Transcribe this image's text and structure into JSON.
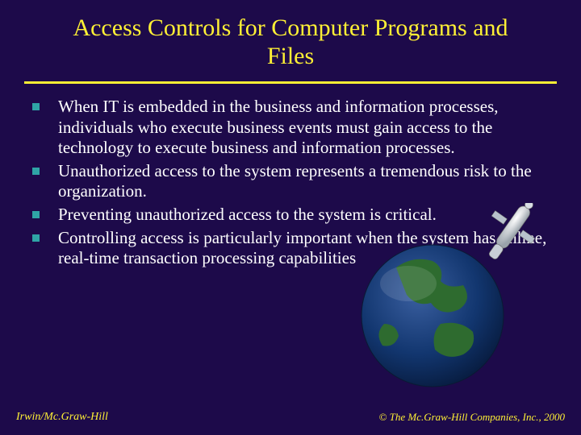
{
  "title": "Access Controls for Computer Programs and Files",
  "bullets": [
    "When IT is embedded in the business and information processes, individuals who execute business events must gain access to the technology to execute business and information processes.",
    "Unauthorized access to the system represents a tremendous risk to the organization.",
    "Preventing unauthorized access to the system is critical.",
    "Controlling access is particularly important when the system has online, real-time transaction processing capabilities"
  ],
  "footer": {
    "left": "Irwin/Mc.Graw-Hill",
    "right": "© The Mc.Graw-Hill Companies, Inc., 2000"
  }
}
